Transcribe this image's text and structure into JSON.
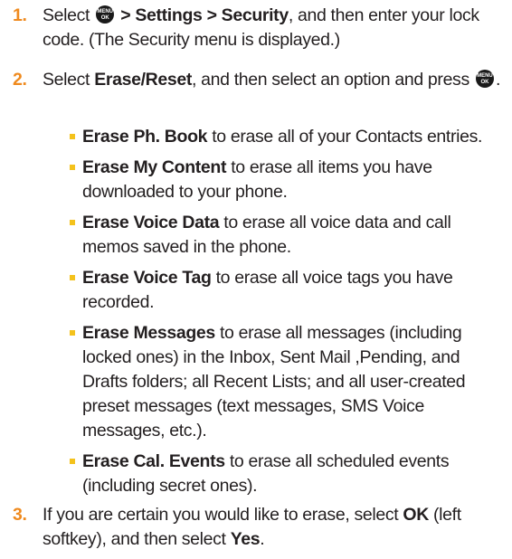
{
  "icon": {
    "name": "menu-ok-key-icon",
    "line1": "MENU",
    "line2": "OK"
  },
  "steps": [
    {
      "number": "1.",
      "select": "Select",
      "path": "> Settings > Security",
      "rest": ", and then enter your lock code. (The Security menu is displayed.)"
    },
    {
      "number": "2.",
      "select": "Select",
      "option": "Erase/Reset",
      "rest": ", and then select an option and press",
      "end": "."
    },
    {
      "number": "3.",
      "lead": "If you are certain you would like to erase, select",
      "ok": "OK",
      "mid": "(left softkey), and then select",
      "yes": "Yes",
      "end": "."
    }
  ],
  "options": [
    {
      "label": "Erase Ph. Book",
      "text": "to erase all of your Contacts entries."
    },
    {
      "label": "Erase My Content",
      "text": "to erase all items you have downloaded to your phone."
    },
    {
      "label": "Erase Voice Data",
      "text": "to erase all voice data and call memos saved in the phone."
    },
    {
      "label": "Erase Voice Tag",
      "text": "to erase all voice tags you have recorded."
    },
    {
      "label": "Erase Messages",
      "text": "to erase all messages (including locked ones) in the Inbox, Sent Mail ,Pending, and Drafts folders; all Recent Lists; and all user-created preset messages (text messages, SMS Voice messages, etc.)."
    },
    {
      "label": "Erase Cal. Events",
      "text": "to erase all scheduled events (including secret ones)."
    }
  ],
  "colors": {
    "number": "#ef8a1e",
    "bullet": "#f4c21c",
    "text": "#231f20"
  }
}
